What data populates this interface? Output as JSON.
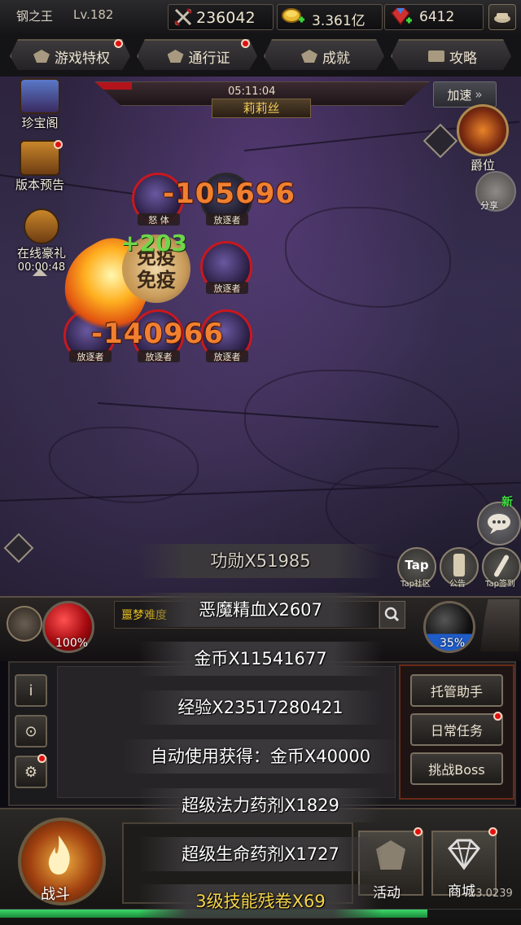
{
  "player": {
    "name": "钢之王",
    "level": "Lv.182"
  },
  "resources": {
    "power": "236042",
    "gold": "3.361亿",
    "gems": "6412"
  },
  "tabs": [
    {
      "label": "游戏特权"
    },
    {
      "label": "通行证"
    },
    {
      "label": "成就"
    },
    {
      "label": "攻略"
    }
  ],
  "boss": {
    "timer": "05:11:04",
    "name": "莉莉丝",
    "hp_fraction": 0.11
  },
  "speed_label": "加速",
  "left_side": [
    {
      "label": "珍宝阁"
    },
    {
      "label": "版本预告"
    },
    {
      "label": "在线豪礼",
      "timer": "00:00:48"
    }
  ],
  "rank_label": "爵位",
  "share_label": "分享",
  "units": [
    {
      "label": "怒 体"
    },
    {
      "label": "放逐者"
    },
    {
      "label": "放逐者"
    },
    {
      "label": "放逐者"
    },
    {
      "label": "放逐者"
    },
    {
      "label": "放逐者"
    }
  ],
  "combat_text": {
    "damage1": "-105696",
    "damage2": "-140966",
    "heal": "+203",
    "immune": [
      "免疫",
      "免疫"
    ]
  },
  "chat_new": "新",
  "quick_buttons": [
    {
      "label": "Tap社区",
      "glyph": "Tap"
    },
    {
      "label": "公告"
    },
    {
      "label": "Tap签到"
    }
  ],
  "hp_percent": "100%",
  "mp_percent": "35%",
  "mp_fill": 0.35,
  "chat_channel": "噩梦难度",
  "right_panel": [
    {
      "label": "托管助手"
    },
    {
      "label": "日常任务"
    },
    {
      "label": "挑战Boss"
    }
  ],
  "left_buttons": [
    {
      "glyph": "i"
    },
    {
      "glyph": "⊙"
    },
    {
      "glyph": "⚙"
    }
  ],
  "bottom_nav": {
    "fight": "战斗",
    "activity": "活动",
    "shop": "商城"
  },
  "exp_fill": 0.82,
  "map_coord": "23.0239",
  "rewards": [
    "功勋X51985",
    "恶魔精血X2607",
    "金币X11541677",
    "经验X23517280421",
    "自动使用获得：金币X40000",
    "超级法力药剂X1829",
    "超级生命药剂X1727",
    "3级技能残卷X69"
  ],
  "colors": {
    "damage": "#f08030",
    "heal": "#6fd64a",
    "hp_orb": "#a40a10",
    "mp_orb": "#1e5cc8",
    "reward_gold": "#f5d448"
  }
}
